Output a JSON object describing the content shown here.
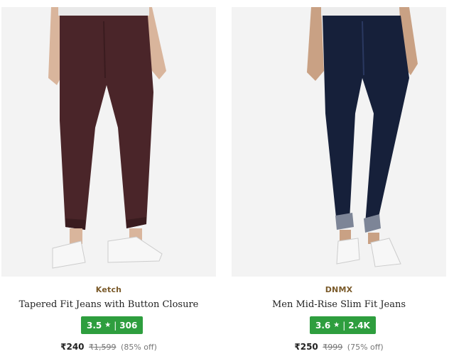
{
  "products": [
    {
      "brand": "Ketch",
      "title": "Tapered Fit Jeans with Button Closure",
      "rating": "3.5",
      "rating_count": "306",
      "price": "₹240",
      "mrp": "₹1,599",
      "discount": "(85% off)",
      "image_icon": "maroon-jeans-photo",
      "pant_color": "#4a2529"
    },
    {
      "brand": "DNMX",
      "title": "Men Mid-Rise Slim Fit Jeans",
      "rating": "3.6",
      "rating_count": "2.4K",
      "price": "₹250",
      "mrp": "₹999",
      "discount": "(75% off)",
      "image_icon": "navy-jeans-photo",
      "pant_color": "#16203a"
    }
  ],
  "ui": {
    "star": "★",
    "separator": "|"
  },
  "colors": {
    "brand": "#7a5a2a",
    "rating_bg": "#2e9e3e"
  }
}
